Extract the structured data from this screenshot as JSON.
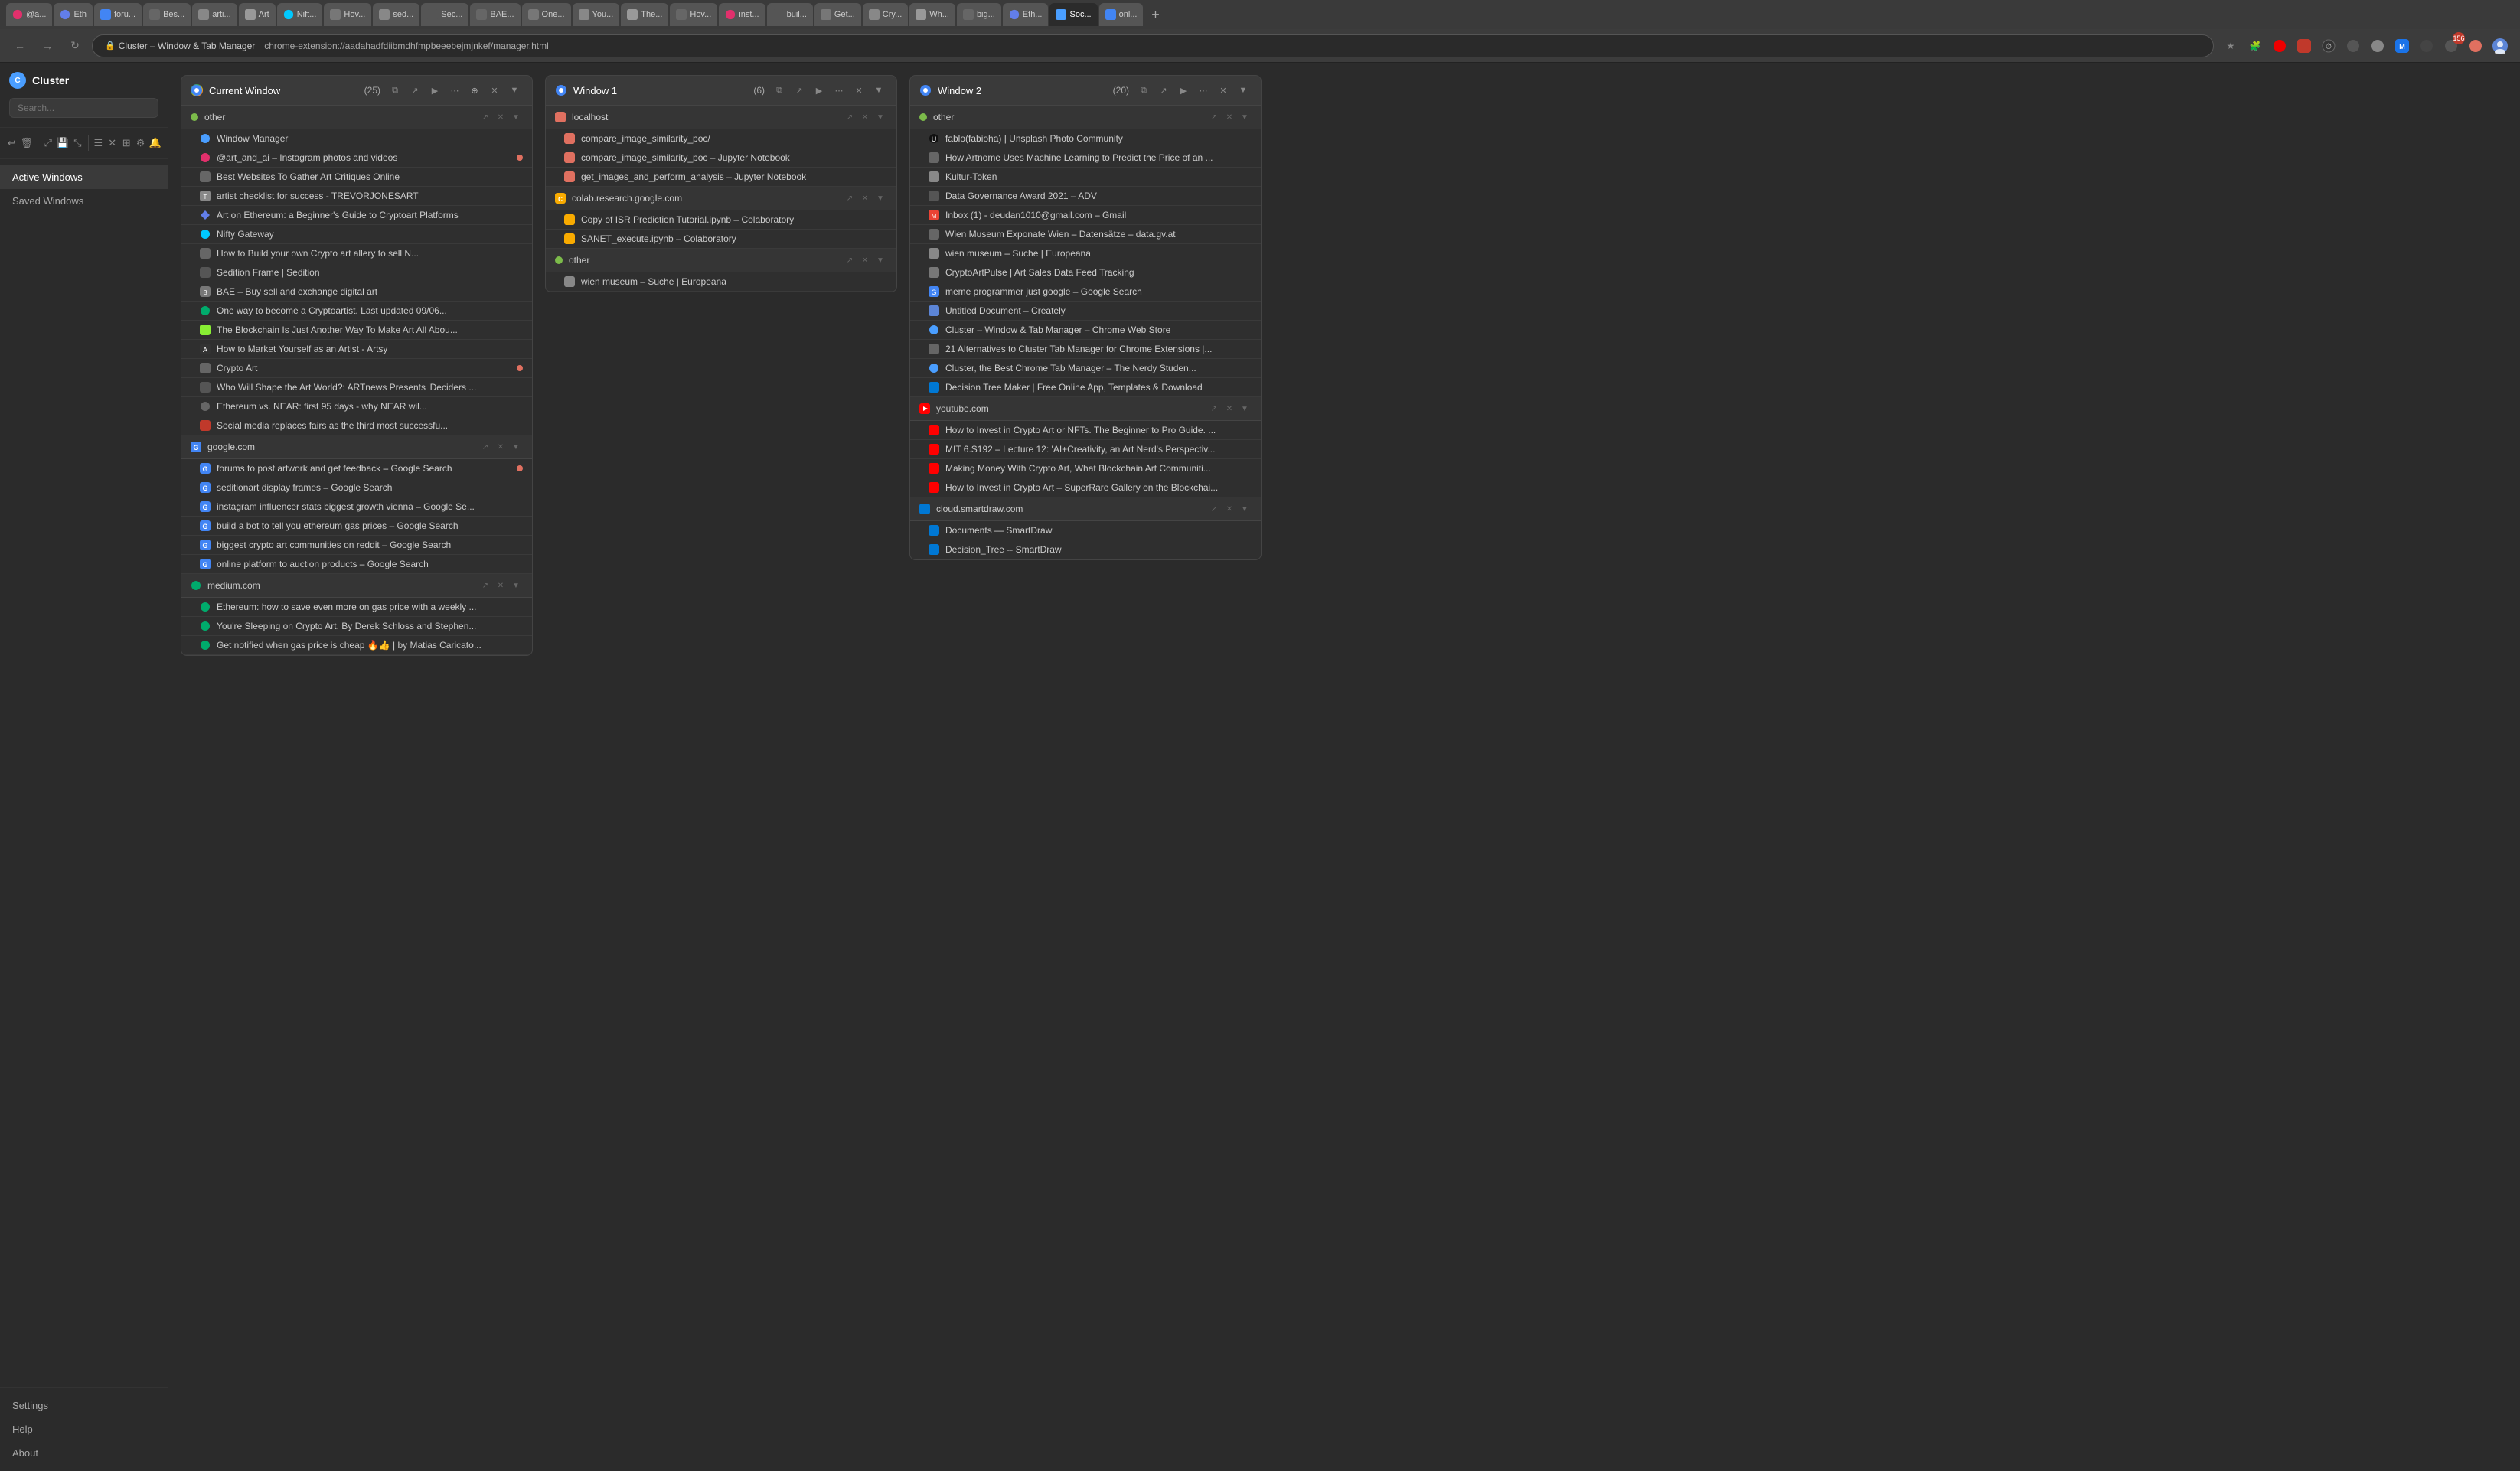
{
  "browser": {
    "tabs": [
      {
        "label": "@a...",
        "active": false,
        "icon": "instagram"
      },
      {
        "label": "Eth",
        "active": false,
        "icon": "eth"
      },
      {
        "label": "foru...",
        "active": false,
        "icon": "generic"
      },
      {
        "label": "Bes...",
        "active": false,
        "icon": "generic"
      },
      {
        "label": "arti...",
        "active": false,
        "icon": "generic"
      },
      {
        "label": "Art",
        "active": false,
        "icon": "generic"
      },
      {
        "label": "Nift...",
        "active": false,
        "icon": "generic"
      },
      {
        "label": "Hov...",
        "active": false,
        "icon": "generic"
      },
      {
        "label": "sed...",
        "active": false,
        "icon": "generic"
      },
      {
        "label": "Sec...",
        "active": false,
        "icon": "generic"
      },
      {
        "label": "BAE...",
        "active": false,
        "icon": "generic"
      },
      {
        "label": "One...",
        "active": false,
        "icon": "generic"
      },
      {
        "label": "You...",
        "active": false,
        "icon": "generic"
      },
      {
        "label": "The...",
        "active": false,
        "icon": "generic"
      },
      {
        "label": "Hov...",
        "active": false,
        "icon": "generic"
      },
      {
        "label": "inst...",
        "active": false,
        "icon": "generic"
      },
      {
        "label": "buil...",
        "active": false,
        "icon": "generic"
      },
      {
        "label": "Get...",
        "active": false,
        "icon": "generic"
      },
      {
        "label": "Cry...",
        "active": false,
        "icon": "generic"
      },
      {
        "label": "Wh...",
        "active": false,
        "icon": "generic"
      },
      {
        "label": "big...",
        "active": false,
        "icon": "generic"
      },
      {
        "label": "Eth...",
        "active": false,
        "icon": "generic"
      },
      {
        "label": "Soc...",
        "active": true,
        "icon": "generic"
      },
      {
        "label": "onl...",
        "active": false,
        "icon": "google"
      }
    ],
    "address": "chrome-extension://aadahadfdiibmdhfmpbeeebejmjnkef/manager.html",
    "title": "Cluster – Window & Tab Manager"
  },
  "sidebar": {
    "logo": "Cluster",
    "search_placeholder": "Search...",
    "nav_items": [
      {
        "label": "Active Windows",
        "active": true
      },
      {
        "label": "Saved Windows",
        "active": false
      }
    ],
    "bottom_items": [
      {
        "label": "Settings"
      },
      {
        "label": "Help"
      },
      {
        "label": "About"
      }
    ]
  },
  "windows": [
    {
      "id": "current",
      "title": "Current Window",
      "count": "(25)",
      "favicon": "chrome",
      "groups": [
        {
          "name": "other",
          "favicon": "other",
          "tabs": [
            {
              "title": "Window Manager",
              "favicon": "generic",
              "dot": false
            },
            {
              "title": "@art_and_ai – Instagram photos and videos",
              "favicon": "instagram",
              "dot": true
            },
            {
              "title": "Best Websites To Gather Art Critiques Online",
              "favicon": "generic",
              "dot": false
            },
            {
              "title": "artist checklist for success - TREVORJONESART",
              "favicon": "generic",
              "dot": false
            },
            {
              "title": "Art on Ethereum: a Beginner's Guide to Cryptoart Platforms",
              "favicon": "eth",
              "dot": false
            },
            {
              "title": "Nifty Gateway",
              "favicon": "nifty",
              "dot": false
            },
            {
              "title": "How to Build your own Crypto art allery to sell N...",
              "favicon": "generic",
              "dot": false
            },
            {
              "title": "Sedition Frame | Sedition",
              "favicon": "generic",
              "dot": false
            },
            {
              "title": "BAE – Buy sell and exchange digital art",
              "favicon": "generic",
              "dot": false
            },
            {
              "title": "One way to become a Cryptoartist. Last updated 09/06...",
              "favicon": "medium",
              "dot": false
            },
            {
              "title": "The Blockchain Is Just Another Way To Make Art All Abou...",
              "favicon": "generic",
              "dot": false
            },
            {
              "title": "How to Market Yourself as an Artist - Artsy",
              "favicon": "artsy",
              "dot": false
            },
            {
              "title": "Crypto Art",
              "favicon": "generic",
              "dot": true
            },
            {
              "title": "Who Will Shape the Art World?: ARTnews Presents 'Deciders ...",
              "favicon": "generic",
              "dot": false
            },
            {
              "title": "Ethereum vs. NEAR: first 95 days - why NEAR wil...",
              "favicon": "generic",
              "dot": false
            },
            {
              "title": "Social media replaces fairs as the third most successfu...",
              "favicon": "generic",
              "dot": false
            }
          ]
        },
        {
          "name": "google.com",
          "favicon": "google",
          "tabs": [
            {
              "title": "forums to post artwork and get feedback – Google Search",
              "favicon": "google",
              "dot": true
            },
            {
              "title": "seditionart display frames – Google Search",
              "favicon": "google",
              "dot": false
            },
            {
              "title": "instagram influencer stats biggest growth vienna – Google Se...",
              "favicon": "google",
              "dot": false
            },
            {
              "title": "build a bot to tell you ethereum gas prices – Google Search",
              "favicon": "google",
              "dot": false
            },
            {
              "title": "biggest crypto art communities on reddit – Google Search",
              "favicon": "google",
              "dot": false
            },
            {
              "title": "online platform to auction products – Google Search",
              "favicon": "google",
              "dot": false
            }
          ]
        },
        {
          "name": "medium.com",
          "favicon": "medium",
          "tabs": [
            {
              "title": "Ethereum: how to save even more on gas price with a weekly ...",
              "favicon": "medium",
              "dot": false
            },
            {
              "title": "You're Sleeping on Crypto Art. By Derek Schloss and Stephen...",
              "favicon": "medium",
              "dot": false
            },
            {
              "title": "Get notified when gas price is cheap 🔥👍 | by Matias Caricato...",
              "favicon": "medium",
              "dot": false
            }
          ]
        }
      ]
    },
    {
      "id": "window1",
      "title": "Window 1",
      "count": "(6)",
      "favicon": "chrome",
      "groups": [
        {
          "name": "localhost",
          "favicon": "localhost",
          "tabs": [
            {
              "title": "compare_image_similarity_poc/",
              "favicon": "generic",
              "dot": false
            },
            {
              "title": "compare_image_similarity_poc – Jupyter Notebook",
              "favicon": "generic",
              "dot": false
            },
            {
              "title": "get_images_and_perform_analysis – Jupyter Notebook",
              "favicon": "generic",
              "dot": false
            }
          ]
        },
        {
          "name": "colab.research.google.com",
          "favicon": "colab",
          "tabs": [
            {
              "title": "Copy of ISR Prediction Tutorial.ipynb – Colaboratory",
              "favicon": "colab",
              "dot": false
            },
            {
              "title": "SANET_execute.ipynb – Colaboratory",
              "favicon": "colab",
              "dot": false
            }
          ]
        },
        {
          "name": "other",
          "favicon": "other",
          "tabs": [
            {
              "title": "wien museum – Suche | Europeana",
              "favicon": "wien",
              "dot": false
            }
          ]
        }
      ]
    },
    {
      "id": "window2",
      "title": "Window 2",
      "count": "(20)",
      "favicon": "chrome",
      "groups": [
        {
          "name": "other",
          "favicon": "other",
          "tabs": [
            {
              "title": "fablo(fabioha) | Unsplash Photo Community",
              "favicon": "unsplash",
              "dot": false
            },
            {
              "title": "How Artnome Uses Machine Learning to Predict the Price of an ...",
              "favicon": "generic",
              "dot": false
            },
            {
              "title": "Kultur-Token",
              "favicon": "generic",
              "dot": false
            },
            {
              "title": "Data Governance Award 2021 – ADV",
              "favicon": "generic",
              "dot": false
            },
            {
              "title": "Inbox (1) - deudan1010@gmail.com – Gmail",
              "favicon": "gmail",
              "dot": false
            },
            {
              "title": "Wien Museum Exponate Wien – Datensätze – data.gv.at",
              "favicon": "generic",
              "dot": false
            },
            {
              "title": "wien museum – Suche | Europeana",
              "favicon": "wien",
              "dot": false
            },
            {
              "title": "CryptoArtPulse | Art Sales Data Feed Tracking",
              "favicon": "generic",
              "dot": false
            },
            {
              "title": "meme programmer just google – Google Search",
              "favicon": "google",
              "dot": false
            },
            {
              "title": "Untitled Document – Creately",
              "favicon": "creately",
              "dot": false
            },
            {
              "title": "Cluster – Window & Tab Manager – Chrome Web Store",
              "favicon": "cluster",
              "dot": false
            },
            {
              "title": "21 Alternatives to Cluster Tab Manager for Chrome Extensions |...",
              "favicon": "generic",
              "dot": false
            },
            {
              "title": "Cluster, the Best Chrome Tab Manager – The Nerdy Studen...",
              "favicon": "cluster",
              "dot": false
            },
            {
              "title": "Decision Tree Maker | Free Online App, Templates & Download",
              "favicon": "smartdraw",
              "dot": false
            }
          ]
        },
        {
          "name": "youtube.com",
          "favicon": "youtube",
          "tabs": [
            {
              "title": "How to Invest in Crypto Art or NFTs. The Beginner to Pro Guide. ...",
              "favicon": "youtube",
              "dot": false
            },
            {
              "title": "MIT 6.S192 – Lecture 12: 'AI+Creativity, an Art Nerd's Perspectiv...",
              "favicon": "youtube",
              "dot": false
            },
            {
              "title": "Making Money With Crypto Art, What Blockchain Art Communiti...",
              "favicon": "youtube",
              "dot": false
            },
            {
              "title": "How to Invest in Crypto Art – SuperRare Gallery on the Blockchai...",
              "favicon": "youtube",
              "dot": false
            }
          ]
        },
        {
          "name": "cloud.smartdraw.com",
          "favicon": "smartdraw",
          "tabs": [
            {
              "title": "Documents — SmartDraw",
              "favicon": "smartdraw",
              "dot": false
            },
            {
              "title": "Decision_Tree -- SmartDraw",
              "favicon": "smartdraw",
              "dot": false
            }
          ]
        }
      ]
    }
  ]
}
